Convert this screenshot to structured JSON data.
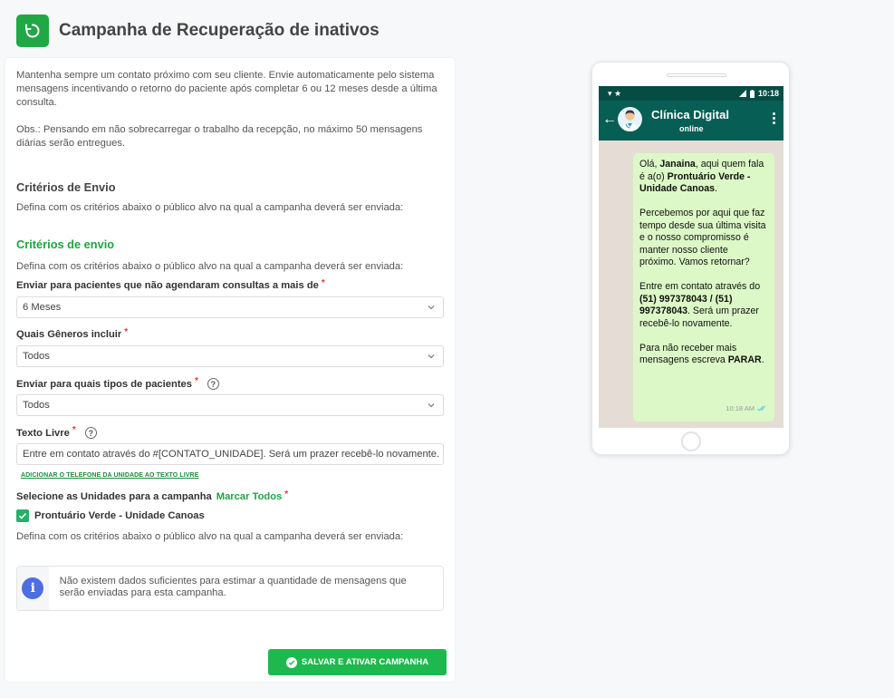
{
  "header": {
    "title": "Campanha de Recuperação de inativos",
    "icon": "refresh-icon"
  },
  "intro": {
    "paragraph1": "Mantenha sempre um contato próximo com seu cliente. Envie automaticamente pelo sistema mensagens incentivando o retorno do paciente após completar 6 ou 12 meses desde a última consulta.",
    "paragraph2": "Obs.: Pensando em não sobrecarregar o trabalho da recepção, no máximo 50 mensagens diárias serão entregues."
  },
  "section1": {
    "title": "Critérios de Envio",
    "description": "Defina com os critérios abaixo o público alvo na qual a campanha deverá ser enviada:"
  },
  "section2": {
    "title": "Critérios de envio",
    "description": "Defina com os critérios abaixo o público alvo na qual a campanha deverá ser enviada:"
  },
  "fields": {
    "months": {
      "label": "Enviar para pacientes que não agendaram consultas a mais de",
      "value": "6 Meses"
    },
    "genders": {
      "label": "Quais Gêneros incluir",
      "value": "Todos"
    },
    "patient_types": {
      "label": "Enviar para quais tipos de pacientes",
      "value": "Todos",
      "help": "?"
    },
    "free_text": {
      "label": "Texto Livre",
      "value": "Entre em contato através do #[CONTATO_UNIDADE]. Será um prazer recebê-lo novamente.",
      "help": "?"
    },
    "required_mark": "*"
  },
  "add_phone_link": "ADICIONAR O TELEFONE DA UNIDADE AO TEXTO LIVRE",
  "units": {
    "label": "Selecione as Unidades para a campanha",
    "mark_all": "Marcar Todos",
    "items": [
      {
        "label": "Prontuário Verde - Unidade Canoas",
        "checked": true
      }
    ],
    "description": "Defina com os critérios abaixo o público alvo na qual a campanha deverá ser enviada:"
  },
  "info": {
    "icon": "i",
    "text": "Não existem dados suficientes para estimar a quantidade de mensagens que serão enviadas para esta campanha."
  },
  "save_button": "SALVAR E ATIVAR CAMPANHA",
  "phone": {
    "time": "10:18",
    "contact_name": "Clínica Digital",
    "contact_status": "online",
    "message": {
      "greeting_pre": "Olá, ",
      "patient": "Janaina",
      "greeting_mid": ", aqui quem fala é a(o) ",
      "clinic": "Prontuário Verde - Unidade Canoas",
      "greeting_end": ".",
      "p2": "Percebemos por aqui que faz tempo desde sua última visita e o nosso compromisso é manter nosso cliente próximo. Vamos retornar?",
      "p3_pre": "Entre em contato através do ",
      "phones": "(51) 997378043 / (51) 997378043",
      "p3_post": ". Será um prazer recebê-lo novamente.",
      "p4_pre": "Para não receber mais mensagens escreva ",
      "stop_word": "PARAR",
      "p4_post": ".",
      "time": "10:18 AM"
    }
  },
  "colors": {
    "brand_green": "#1da543",
    "whatsapp_dark": "#075e54",
    "bubble": "#dcf8c6",
    "info_blue": "#4d6ee0"
  }
}
